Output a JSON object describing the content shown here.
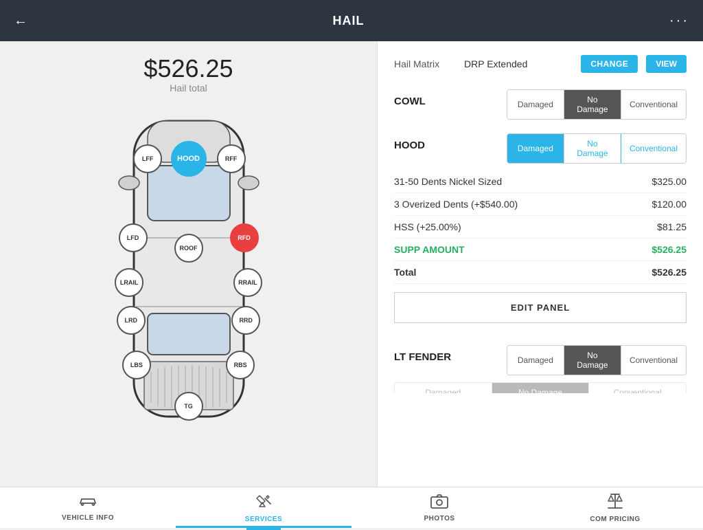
{
  "header": {
    "title": "HAIL",
    "back_icon": "←",
    "menu_icon": "···"
  },
  "left_panel": {
    "amount": "$526.25",
    "amount_label": "Hail total",
    "panels": [
      {
        "id": "LFF",
        "x": "28%",
        "y": "17%",
        "state": "normal"
      },
      {
        "id": "HOOD",
        "x": "50%",
        "y": "17%",
        "state": "active-blue"
      },
      {
        "id": "RFF",
        "x": "72%",
        "y": "17%",
        "state": "normal"
      },
      {
        "id": "LFD",
        "x": "22%",
        "y": "40%",
        "state": "normal"
      },
      {
        "id": "ROOF",
        "x": "50%",
        "y": "42%",
        "state": "normal"
      },
      {
        "id": "RFD",
        "x": "78%",
        "y": "40%",
        "state": "active-red"
      },
      {
        "id": "LRAIL",
        "x": "24%",
        "y": "52%",
        "state": "normal"
      },
      {
        "id": "RRAIL",
        "x": "76%",
        "y": "52%",
        "state": "normal"
      },
      {
        "id": "LRD",
        "x": "22%",
        "y": "62%",
        "state": "normal"
      },
      {
        "id": "RRD",
        "x": "78%",
        "y": "62%",
        "state": "normal"
      },
      {
        "id": "LBS",
        "x": "24%",
        "y": "76%",
        "state": "normal"
      },
      {
        "id": "RBS",
        "x": "76%",
        "y": "76%",
        "state": "normal"
      },
      {
        "id": "TG",
        "x": "50%",
        "y": "88%",
        "state": "normal"
      }
    ]
  },
  "right_panel": {
    "hail_matrix": {
      "label": "Hail Matrix",
      "value": "DRP Extended",
      "change_label": "CHANGE",
      "view_label": "VIEW"
    },
    "cowl": {
      "title": "COWL",
      "options": [
        "Damaged",
        "No Damage",
        "Conventional"
      ],
      "active": "No Damage",
      "active_style": "dark"
    },
    "hood": {
      "title": "HOOD",
      "options": [
        "Damaged",
        "No Damage",
        "Conventional"
      ],
      "active": "Damaged",
      "active_style": "blue",
      "line_items": [
        {
          "label": "31-50 Dents Nickel Sized",
          "value": "$325.00"
        },
        {
          "label": "3 Overized Dents (+$540.00)",
          "value": "$120.00"
        },
        {
          "label": "HSS (+25.00%)",
          "value": "$81.25"
        },
        {
          "label": "SUPP AMOUNT",
          "value": "$526.25",
          "type": "supp"
        },
        {
          "label": "Total",
          "value": "$526.25",
          "type": "total"
        }
      ],
      "edit_btn": "EDIT PANEL"
    },
    "lt_fender": {
      "title": "LT FENDER",
      "options": [
        "Damaged",
        "No Damage",
        "Conventional"
      ],
      "active": "No Damage",
      "active_style": "dark"
    }
  },
  "bottom_nav": {
    "items": [
      {
        "id": "vehicle-info",
        "label": "VEHICLE INFO",
        "icon": "car"
      },
      {
        "id": "services",
        "label": "SERVICES",
        "icon": "tools",
        "active": true
      },
      {
        "id": "photos",
        "label": "PHOTOS",
        "icon": "camera"
      },
      {
        "id": "com-pricing",
        "label": "COM PRICING",
        "icon": "scale"
      }
    ]
  }
}
